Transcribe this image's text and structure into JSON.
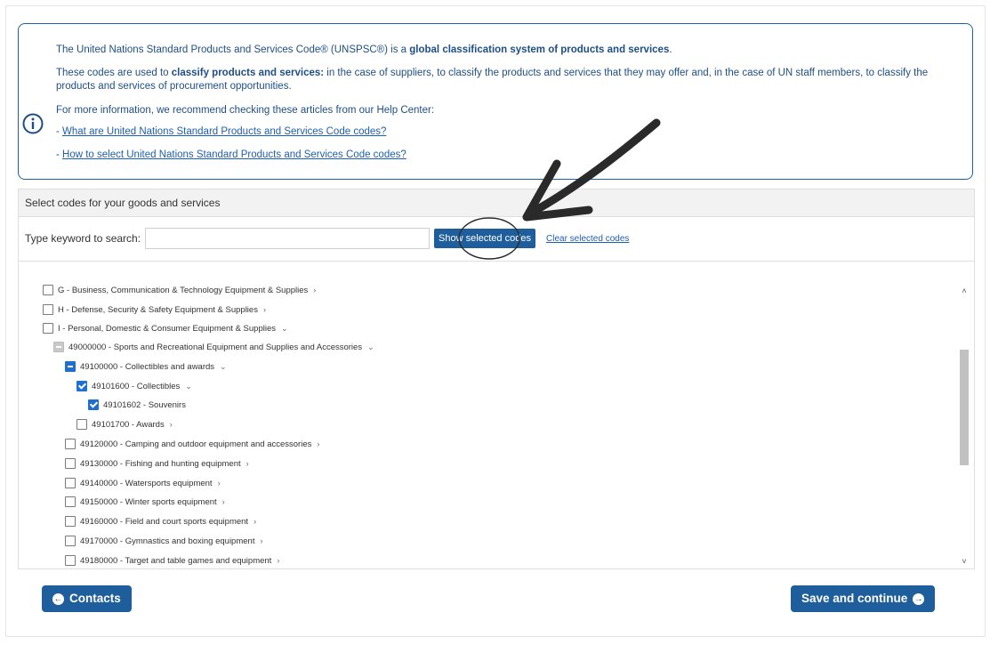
{
  "info": {
    "line1_a": "The United Nations Standard Products and Services Code® (UNSPSC®) is a ",
    "line1_b": "global classification system of products and services",
    "line1_c": ".",
    "line2_a": "These codes are used to ",
    "line2_b": "classify products and services:",
    "line2_c": " in the case of suppliers, to classify the products and services that they may offer and, in the case of UN staff members, to classify the products and services of procurement opportunities.",
    "line3": "For more information, we recommend checking these articles from our Help Center:",
    "link1_prefix": "- ",
    "link1": "What are United Nations Standard Products and Services Code codes?",
    "link2_prefix": "- ",
    "link2": "How to select United Nations Standard Products and Services Code codes?",
    "icon": "info-circle-icon"
  },
  "panel": {
    "title": "Select codes for your goods and services",
    "search_label": "Type keyword to search:",
    "search_value": "",
    "show_selected_label": "Show selected codes",
    "clear_selected_label": "Clear selected codes"
  },
  "tree": [
    {
      "label": "G - Business, Communication & Technology Equipment & Supplies",
      "state": "unchecked",
      "chevron": "right"
    },
    {
      "label": "H - Defense, Security & Safety Equipment & Supplies",
      "state": "unchecked",
      "chevron": "right"
    },
    {
      "label": "I - Personal, Domestic & Consumer Equipment & Supplies",
      "state": "unchecked",
      "chevron": "down"
    },
    {
      "label": "49000000 - Sports and Recreational Equipment and Supplies and Accessories",
      "state": "partial-grey",
      "chevron": "down"
    },
    {
      "label": "49100000 - Collectibles and awards",
      "state": "partial",
      "chevron": "down"
    },
    {
      "label": "49101600 - Collectibles",
      "state": "checked",
      "chevron": "down"
    },
    {
      "label": "49101602 - Souvenirs",
      "state": "checked",
      "chevron": ""
    },
    {
      "label": "49101700 - Awards",
      "state": "unchecked",
      "chevron": "right"
    },
    {
      "label": "49120000 - Camping and outdoor equipment and accessories",
      "state": "unchecked",
      "chevron": "right"
    },
    {
      "label": "49130000 - Fishing and hunting equipment",
      "state": "unchecked",
      "chevron": "right"
    },
    {
      "label": "49140000 - Watersports equipment",
      "state": "unchecked",
      "chevron": "right"
    },
    {
      "label": "49150000 - Winter sports equipment",
      "state": "unchecked",
      "chevron": "right"
    },
    {
      "label": "49160000 - Field and court sports equipment",
      "state": "unchecked",
      "chevron": "right"
    },
    {
      "label": "49170000 - Gymnastics and boxing equipment",
      "state": "unchecked",
      "chevron": "right"
    },
    {
      "label": "49180000 - Target and table games and equipment",
      "state": "unchecked",
      "chevron": "right"
    }
  ],
  "nav": {
    "prev_label": "Contacts",
    "next_label": "Save and continue",
    "prev_icon": "arrow-left-circle-icon",
    "next_icon": "arrow-right-circle-icon"
  },
  "colors": {
    "primary": "#1f5e9c",
    "info_text": "#1d4f86",
    "checkbox_checked": "#1f6fd1"
  }
}
